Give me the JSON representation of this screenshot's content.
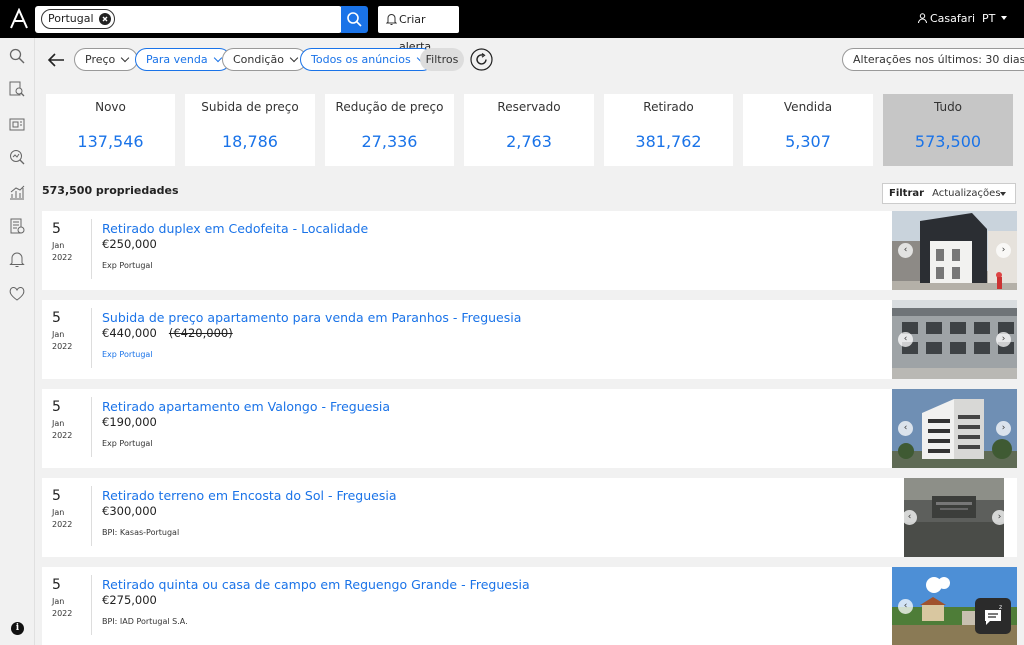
{
  "topbar": {
    "search_chip": "Portugal",
    "alert_label": "Criar alerta",
    "user_name": "Casafari",
    "language": "PT"
  },
  "filters": {
    "pills": [
      "Preço",
      "Para venda",
      "Condição",
      "Todos os anúncios"
    ],
    "filtros_label": "Filtros",
    "changes_label": "Alterações nos últimos: 30 dias"
  },
  "stats": [
    {
      "label": "Novo",
      "value": "137,546"
    },
    {
      "label": "Subida de preço",
      "value": "18,786"
    },
    {
      "label": "Redução de preço",
      "value": "27,336"
    },
    {
      "label": "Reservado",
      "value": "2,763"
    },
    {
      "label": "Retirado",
      "value": "381,762"
    },
    {
      "label": "Vendida",
      "value": "5,307"
    },
    {
      "label": "Tudo",
      "value": "573,500"
    }
  ],
  "results": {
    "count": "573,500 propriedades",
    "filter_label": "Filtrar",
    "filter_value": "Actualizações"
  },
  "listings": [
    {
      "day": "5",
      "month": "Jan",
      "year": "2022",
      "title": "Retirado duplex em Cedofeita - Localidade",
      "price": "€250,000",
      "old_price": "",
      "agency": "Exp Portugal"
    },
    {
      "day": "5",
      "month": "Jan",
      "year": "2022",
      "title": "Subida de preço apartamento para venda em Paranhos - Freguesia",
      "price": "€440,000",
      "old_price": "(€420,000)",
      "agency": "Exp Portugal"
    },
    {
      "day": "5",
      "month": "Jan",
      "year": "2022",
      "title": "Retirado apartamento em Valongo - Freguesia",
      "price": "€190,000",
      "old_price": "",
      "agency": "Exp Portugal"
    },
    {
      "day": "5",
      "month": "Jan",
      "year": "2022",
      "title": "Retirado terreno em Encosta do Sol - Freguesia",
      "price": "€300,000",
      "old_price": "",
      "agency": "BPI: Kasas-Portugal"
    },
    {
      "day": "5",
      "month": "Jan",
      "year": "2022",
      "title": "Retirado quinta ou casa de campo em Reguengo Grande - Freguesia",
      "price": "€275,000",
      "old_price": "",
      "agency": "BPI: IAD Portugal S.A."
    }
  ],
  "colors": {
    "accent": "#1a73e8",
    "topbar": "#000000",
    "selected_card": "#c6c6c6"
  }
}
